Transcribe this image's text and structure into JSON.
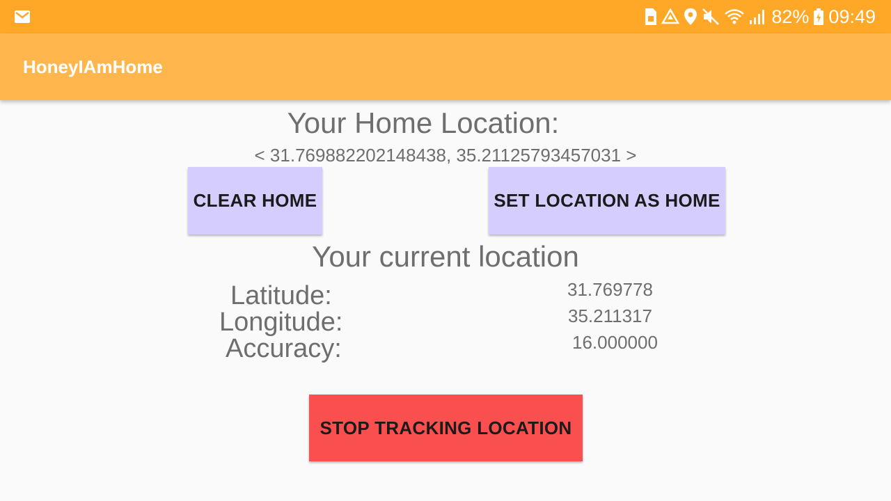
{
  "status_bar": {
    "left_icons": [
      "gmail-icon"
    ],
    "right_icons": [
      "sim-icon",
      "recycle-icon",
      "location-pin-icon",
      "mute-icon",
      "wifi-icon",
      "signal-icon",
      "battery-charging-icon"
    ],
    "battery": "82%",
    "time": "09:49"
  },
  "app_bar": {
    "title": "HoneyIAmHome"
  },
  "home": {
    "title": "Your Home Location:",
    "coords": "< 31.769882202148438, 35.21125793457031 >"
  },
  "buttons": {
    "clear_home": "CLEAR HOME",
    "set_home": "SET LOCATION AS HOME",
    "stop_tracking": "STOP TRACKING LOCATION"
  },
  "current": {
    "title": "Your current location",
    "latitude_label": "Latitude:",
    "latitude_value": "31.769778",
    "longitude_label": "Longitude:",
    "longitude_value": "35.211317",
    "accuracy_label": "Accuracy:",
    "accuracy_value": "16.000000"
  },
  "colors": {
    "status_bar": "#ffa726",
    "app_bar": "#ffb74d",
    "home_buttons": "#d6cdff",
    "stop_button": "#fa4f4f"
  }
}
